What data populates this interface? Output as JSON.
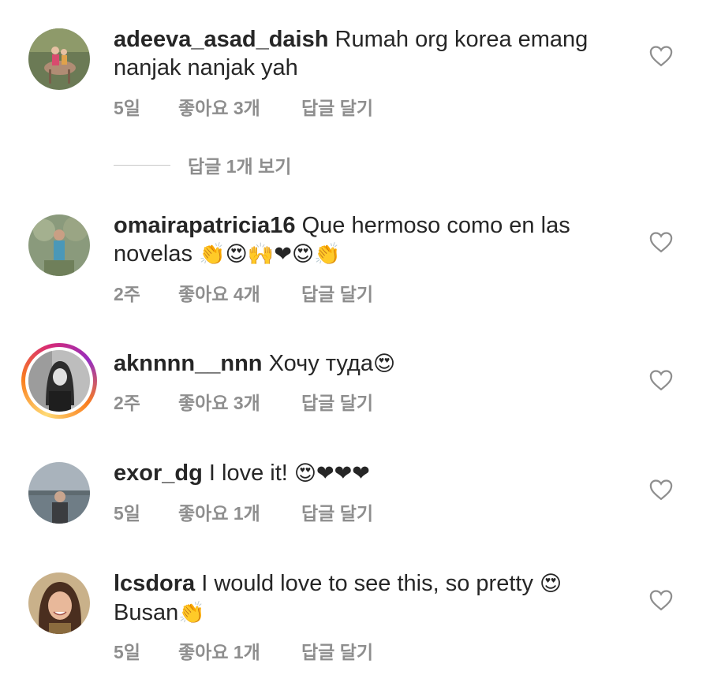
{
  "comments": [
    {
      "username": "adeeva_asad_daish",
      "text": "Rumah org korea emang nanjak nanjak yah",
      "emoji": "",
      "time": "5일",
      "likes": "좋아요 3개",
      "reply_label": "답글 달기",
      "avatar": "person-on-horse-photo"
    },
    {
      "username": "omairapatricia16",
      "text": "Que hermoso como en las novelas",
      "emoji": "👏😍🙌❤😍👏",
      "time": "2주",
      "likes": "좋아요 4개",
      "reply_label": "답글 달기",
      "avatar": "woman-outdoors-photo"
    },
    {
      "username": "aknnnn__nnn",
      "text": "Хочу туда",
      "emoji": "😍",
      "time": "2주",
      "likes": "좋아요 3개",
      "reply_label": "답글 달기",
      "avatar": "woman-bw-photo-story-ring"
    },
    {
      "username": "exor_dg",
      "text": "I love it!",
      "emoji": "😍❤❤❤",
      "time": "5일",
      "likes": "좋아요 1개",
      "reply_label": "답글 달기",
      "avatar": "man-by-water-photo"
    },
    {
      "username": "lcsdora",
      "text": "I would love to see this, so pretty",
      "emoji": "😍",
      "text2": "Busan",
      "emoji2": "👏",
      "time": "5일",
      "likes": "좋아요 1개",
      "reply_label": "답글 달기",
      "avatar": "smiling-woman-photo"
    }
  ],
  "view_replies_label": "답글 1개 보기",
  "icons": {
    "like": "heart-outline-icon"
  },
  "colors": {
    "text": "#262626",
    "meta": "#8e8e8e",
    "ring_start": "#feda75",
    "ring_end": "#d62976"
  }
}
